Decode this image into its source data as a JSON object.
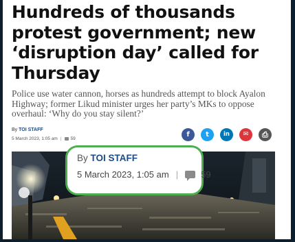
{
  "article": {
    "headline": "Hundreds of thousands protest government; new ‘disruption day’ called for Thursday",
    "subheadline": "Police use water cannon, horses as hundreds attempt to block Ayalon Highway; former Likud minister urges her party’s MKs to oppose overhaul: ‘Why do you stay silent?’",
    "byline": {
      "prefix": "By",
      "author": "TOI STAFF",
      "date": "5 March 2023, 1:05 am",
      "separator": "|",
      "comment_count": "59"
    },
    "share": [
      {
        "name": "facebook",
        "glyph": "f",
        "color": "#3b5998"
      },
      {
        "name": "twitter",
        "glyph": "t",
        "color": "#1da1f2"
      },
      {
        "name": "linkedin",
        "glyph": "in",
        "color": "#0077b5"
      },
      {
        "name": "email",
        "glyph": "✉",
        "color": "#e0343b"
      },
      {
        "name": "print",
        "glyph": "⎙",
        "color": "#555555"
      }
    ]
  },
  "highlight": {
    "border_color": "#4cae4c"
  }
}
